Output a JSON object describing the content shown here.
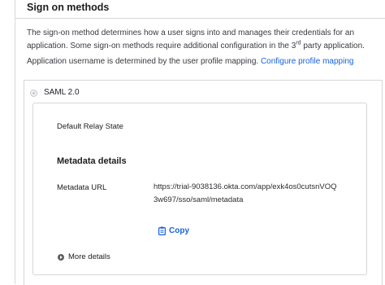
{
  "section": {
    "title": "Sign on methods",
    "description_part1": "The sign-on method determines how a user signs into and manages their credentials for an application. Some sign-on methods require additional configuration in the 3",
    "description_sup": "rd",
    "description_part2": " party application.",
    "username_note": "Application username is determined by the user profile mapping.",
    "configure_link": "Configure profile mapping"
  },
  "saml": {
    "label": "SAML 2.0",
    "relay_state_label": "Default Relay State",
    "metadata_heading": "Metadata details",
    "metadata_url_label": "Metadata URL",
    "metadata_url_value": "https://trial-9038136.okta.com/app/exk4os0cutsnVOQ3w697/sso/saml/metadata",
    "copy_label": "Copy",
    "more_details_label": "More details"
  },
  "colors": {
    "link": "#1662dd",
    "border": "#d7d7dc"
  },
  "icons": {
    "copy": "clipboard-icon",
    "more": "chevron-right-circle-icon",
    "radio": "radio-icon"
  }
}
